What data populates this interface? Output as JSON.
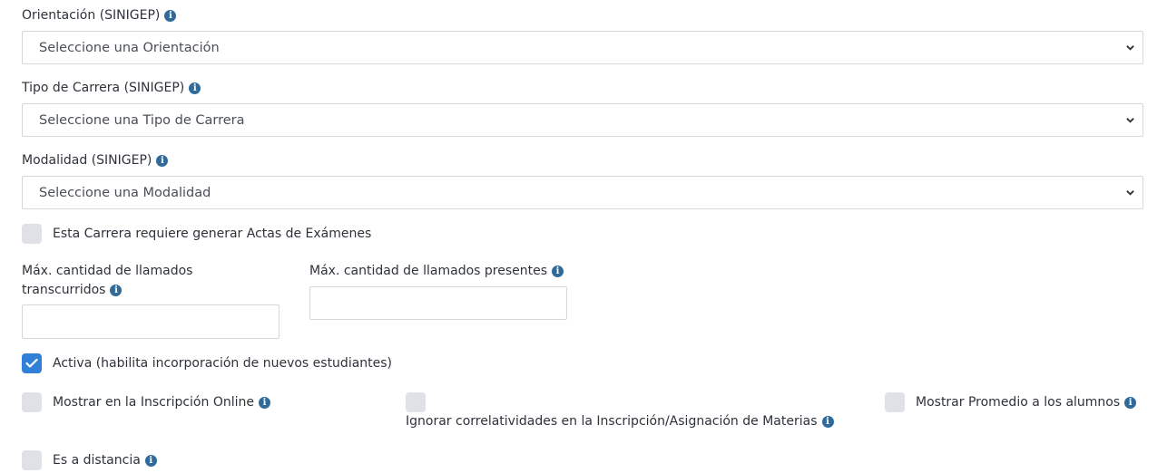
{
  "fields": {
    "orientacion": {
      "label": "Orientación (SINIGEP)",
      "placeholder": "Seleccione una Orientación"
    },
    "tipo_carrera": {
      "label": "Tipo de Carrera (SINIGEP)",
      "placeholder": "Seleccione una Tipo de Carrera"
    },
    "modalidad": {
      "label": "Modalidad (SINIGEP)",
      "placeholder": "Seleccione una Modalidad"
    },
    "llamados_transcurridos": {
      "label_line1": "Máx. cantidad de llamados",
      "label_line2": "transcurridos",
      "value": ""
    },
    "llamados_presentes": {
      "label": "Máx. cantidad de llamados presentes",
      "value": ""
    }
  },
  "checkboxes": {
    "actas": {
      "label": "Esta Carrera requiere generar Actas de Exámenes",
      "checked": false
    },
    "activa": {
      "label": "Activa (habilita incorporación de nuevos estudiantes)",
      "checked": true
    },
    "inscripcion_online": {
      "label": "Mostrar en la Inscripción Online",
      "checked": false
    },
    "ignorar_correlatividades": {
      "label": "Ignorar correlatividades en la Inscripción/Asignación de Materias",
      "checked": false
    },
    "mostrar_promedio": {
      "label": "Mostrar Promedio a los alumnos",
      "checked": false
    },
    "distancia": {
      "label": "Es a distancia",
      "checked": false
    }
  },
  "icons": {
    "info": "info-icon",
    "chevron": "chevron-down-icon",
    "check": "check-icon"
  },
  "colors": {
    "info": "#2f6a9a",
    "checked": "#2f80d6",
    "unchecked": "#dfe1e6",
    "border": "#d4d7dd"
  }
}
